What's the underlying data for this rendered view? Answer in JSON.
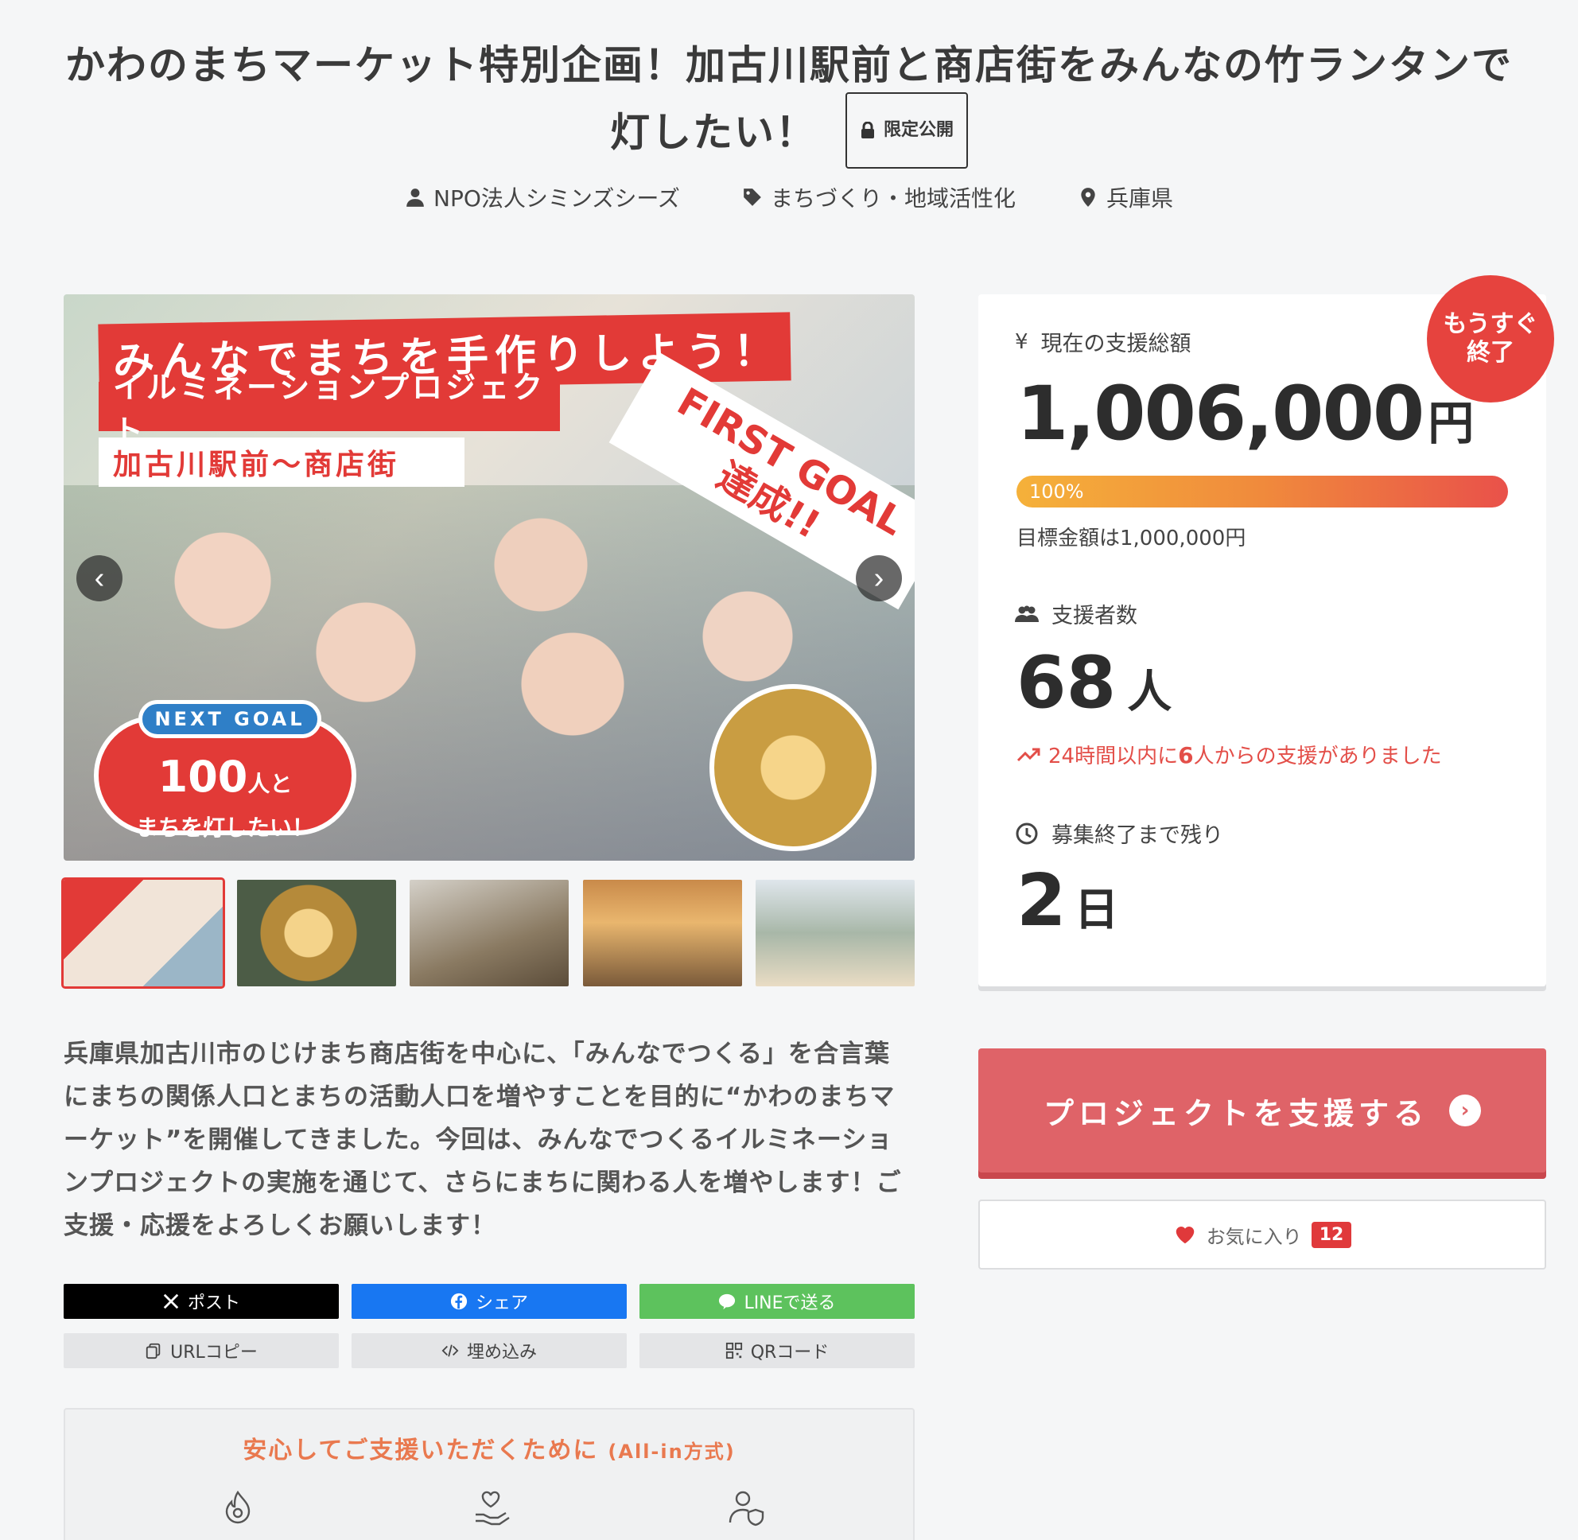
{
  "header": {
    "title": "かわのまちマーケット特別企画！加古川駅前と商店街をみんなの竹ランタンで灯したい！",
    "private_badge": "限定公開"
  },
  "meta": {
    "organizer": "NPO法人シミンズシーズ",
    "category": "まちづくり・地域活性化",
    "location": "兵庫県"
  },
  "hero": {
    "band1": "みんなでまちを手作りしよう！",
    "band2": "イルミネーションプロジェクト",
    "band3": "加古川駅前〜商店街",
    "goal_banner_1": "FIRST GOAL",
    "goal_banner_2": "達成!!",
    "next_goal_pill": "NEXT GOAL",
    "next_goal_num": "100",
    "next_goal_unit": "人と",
    "next_goal_sub": "まちを灯したい！",
    "prev_icon": "chevron-left-icon",
    "next_icon": "chevron-right-icon"
  },
  "description": "兵庫県加古川市のじけまち商店街を中心に、「みんなでつくる」を合言葉にまちの関係人口とまちの活動人口を増やすことを目的に“かわのまちマーケット”を開催してきました。今回は、みんなでつくるイルミネーションプロジェクトの実施を通じて、さらにまちに関わる人を増やします！ご支援・応援をよろしくお願いします！",
  "share": {
    "x": "ポスト",
    "facebook": "シェア",
    "line": "LINEで送る",
    "url_copy": "URLコピー",
    "embed": "埋め込み",
    "qr": "QRコード"
  },
  "safety": {
    "title": "安心してご支援いただくために",
    "mode": "(All-in方式)"
  },
  "stats": {
    "ending_line1": "もうすぐ",
    "ending_line2": "終了",
    "amount_label": "現在の支援総額",
    "amount": "1,006,000",
    "amount_unit": "円",
    "progress_percent": 100,
    "progress_label": "100%",
    "goal_text": "目標金額は1,000,000円",
    "supporters_label": "支援者数",
    "supporters": "68",
    "supporters_unit": "人",
    "trend_pre": "24時間以内に",
    "trend_num": "6",
    "trend_post": "人からの支援がありました",
    "remaining_label": "募集終了まで残り",
    "remaining": "2",
    "remaining_unit": "日"
  },
  "actions": {
    "support_label": "プロジェクトを支援する",
    "favorite_label": "お気に入り",
    "favorite_count": "12"
  },
  "colors": {
    "accent_red": "#df6368",
    "badge_red": "#e6433e",
    "trend_red": "#e34e48",
    "safety_orange": "#e9794f"
  }
}
